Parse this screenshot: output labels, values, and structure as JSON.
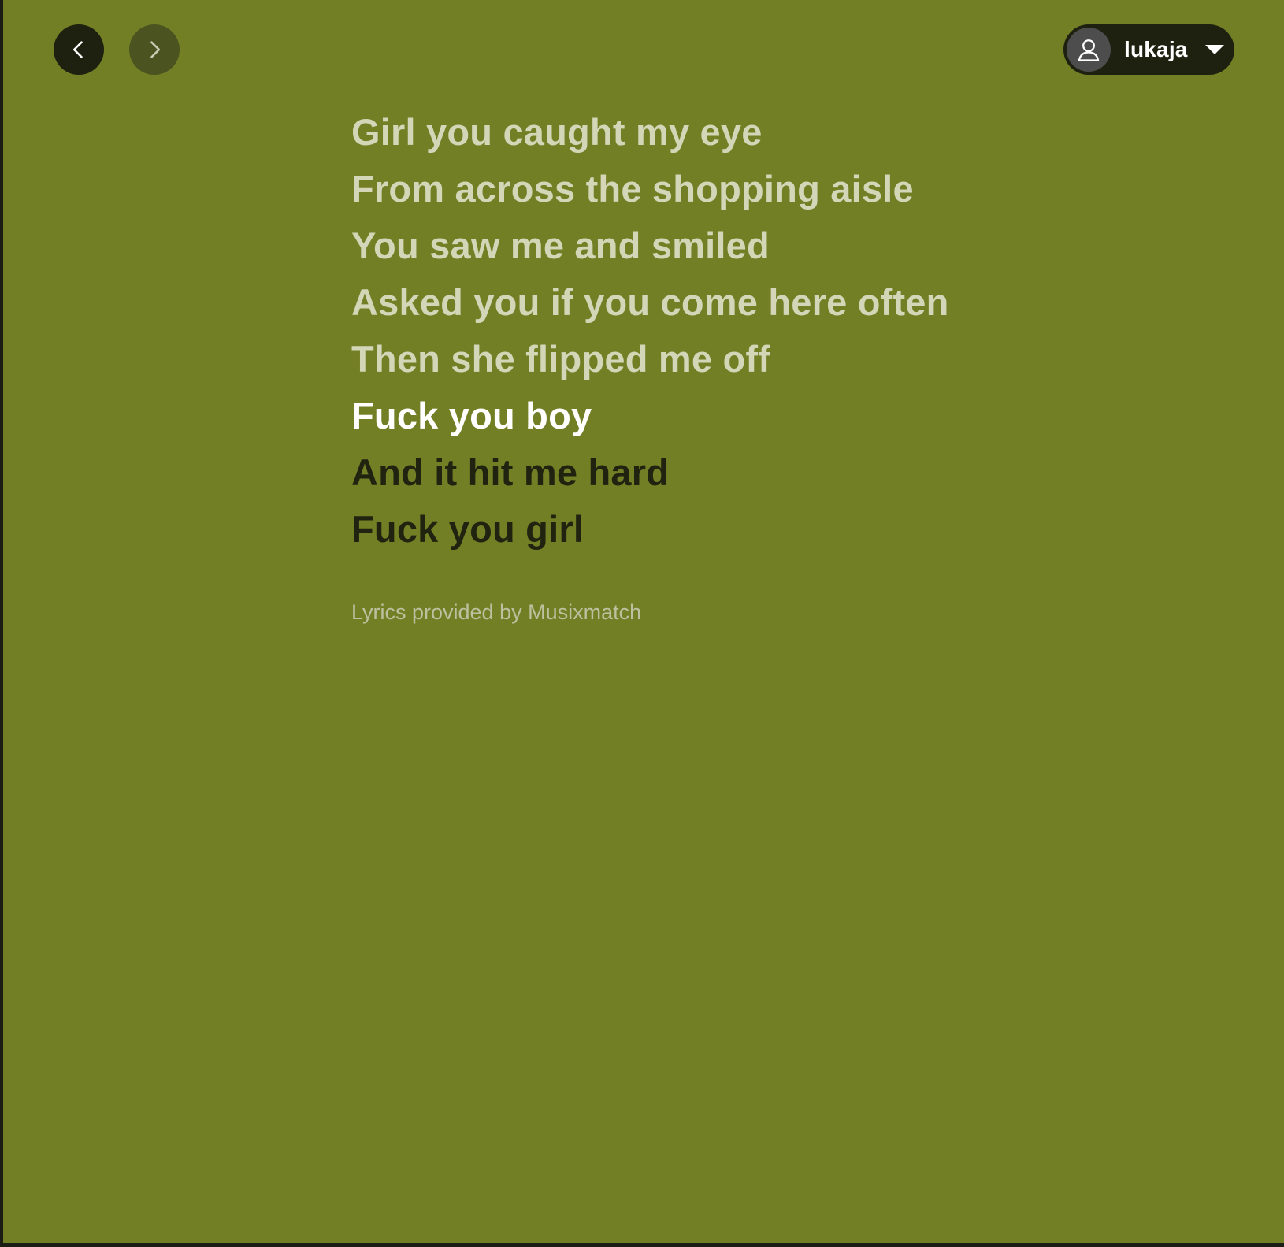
{
  "header": {
    "back_icon": "chevron-left-icon",
    "forward_icon": "chevron-right-icon",
    "user": {
      "avatar_icon": "user-icon",
      "name": "lukaja",
      "dropdown_icon": "caret-down-icon"
    }
  },
  "lyrics": {
    "lines": [
      {
        "text": "Girl you caught my eye",
        "state": "past"
      },
      {
        "text": "From across the shopping aisle",
        "state": "past"
      },
      {
        "text": "You saw me and smiled",
        "state": "past"
      },
      {
        "text": "Asked you if you come here often",
        "state": "past"
      },
      {
        "text": "Then she flipped me off",
        "state": "past"
      },
      {
        "text": "Fuck you boy",
        "state": "current"
      },
      {
        "text": "And it hit me hard",
        "state": "upcoming"
      },
      {
        "text": "Fuck you girl",
        "state": "upcoming"
      }
    ],
    "credit": "Lyrics provided by Musixmatch"
  },
  "colors": {
    "background": "#737f25",
    "past_line": "#d3d6b7",
    "current_line": "#ffffff",
    "upcoming_line": "#1f2310"
  }
}
